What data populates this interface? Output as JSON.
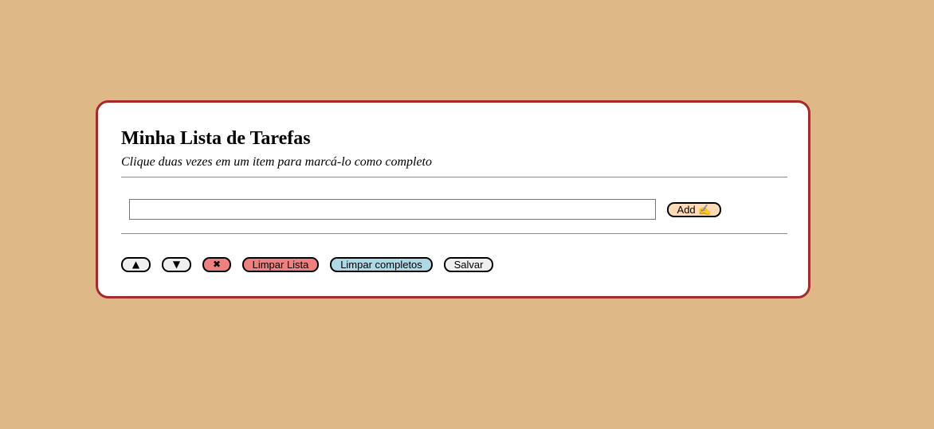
{
  "page": {
    "title": "Minha Lista de Tarefas",
    "subtitle": "Clique duas vezes em um item para marcá-lo como completo"
  },
  "input": {
    "value": "",
    "placeholder": ""
  },
  "buttons": {
    "add_label": "Add ✍",
    "move_up_label": "▲",
    "move_down_label": "▼",
    "remove_label": "✖",
    "clear_list_label": "Limpar Lista",
    "clear_completed_label": "Limpar completos",
    "save_label": "Salvar"
  },
  "colors": {
    "background": "#deb887",
    "card_border": "#a52a2a",
    "add_button": "#ffdab9",
    "danger_button": "#f08080",
    "info_button": "#add8e6",
    "neutral_button": "#efefef"
  }
}
